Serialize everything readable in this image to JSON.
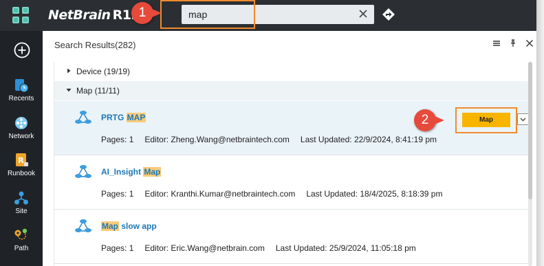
{
  "topbar": {
    "brand_name": "NetBrain",
    "brand_version": "R12",
    "search_value": "map",
    "search_placeholder": ""
  },
  "badges": {
    "step1": "1",
    "step2": "2"
  },
  "sidebar": {
    "items": [
      {
        "label": "Recents",
        "icon": "recents-icon"
      },
      {
        "label": "Network",
        "icon": "network-icon"
      },
      {
        "label": "Runbook",
        "icon": "runbook-icon"
      },
      {
        "label": "Site",
        "icon": "site-icon"
      },
      {
        "label": "Path",
        "icon": "path-icon"
      }
    ]
  },
  "panel": {
    "title": "Search Results(282)",
    "groups": [
      {
        "label": "Device (19/19)",
        "expanded": false
      },
      {
        "label": "Map (11/11)",
        "expanded": true
      }
    ],
    "results": [
      {
        "title_pre": "PRTG ",
        "title_hl": "MAP",
        "title_post": "",
        "pages": "Pages: 1",
        "editor": "Editor: Zheng.Wang@netbraintech.com",
        "updated": "Last Updated: 22/9/2024, 8:41:19 pm",
        "selected": true,
        "button_label": "Map"
      },
      {
        "title_pre": "AI_Insight ",
        "title_hl": "Map",
        "title_post": "",
        "pages": "Pages: 1",
        "editor": "Editor: Kranthi.Kumar@netbraintech.com",
        "updated": "Last Updated: 18/4/2025, 8:18:39 pm",
        "selected": false
      },
      {
        "title_pre": "",
        "title_hl": "Map",
        "title_post": " slow app",
        "pages": "Pages: 1",
        "editor": "Editor: Eric.Wang@netbrain.com",
        "updated": "Last Updated: 25/9/2024, 11:05:18 pm",
        "selected": false
      }
    ]
  },
  "colors": {
    "topbar": "#2b2f33",
    "sidebar": "#1f2327",
    "accent_button": "#f7b500",
    "highlight": "#f9cb7a",
    "link": "#1d77b5",
    "annotation": "#f28a2c",
    "badge": "#e64a3b"
  }
}
